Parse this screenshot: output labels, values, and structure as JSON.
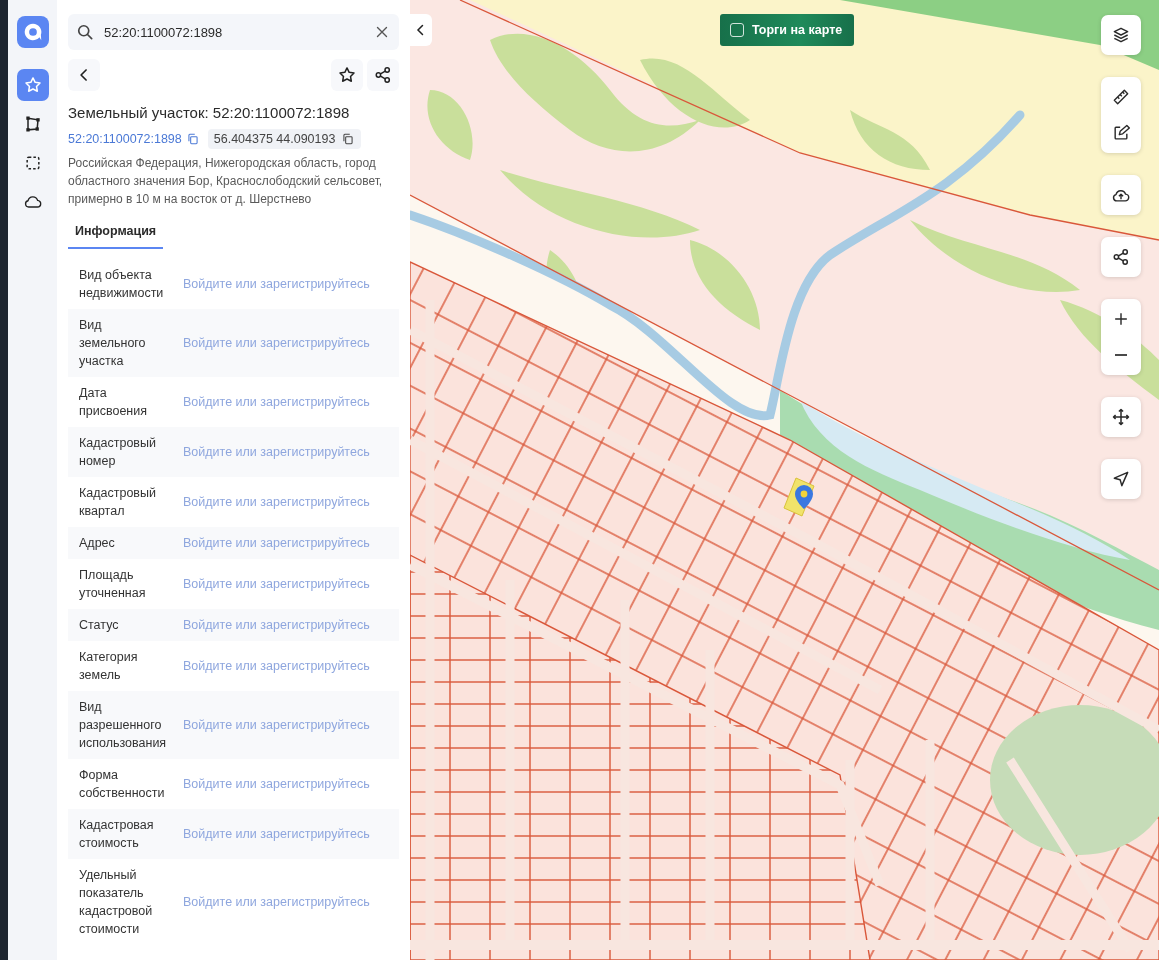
{
  "rail": [
    {
      "selected": true
    },
    {
      "selected": false
    },
    {
      "selected": false
    },
    {
      "selected": false
    }
  ],
  "search": {
    "value": "52:20:1100072:1898"
  },
  "object": {
    "title": "Земельный участок: 52:20:1100072:1898",
    "cadastral_link": "52:20:1100072:1898",
    "coordinates": "56.404375 44.090193",
    "address": "Российская Федерация, Нижегородская область, город областного значения Бор, Краснослободский сельсовет, примерно в 10 м на восток от д. Шерстнево"
  },
  "tabs": [
    {
      "label": "Информация",
      "selected": true
    }
  ],
  "rows": [
    {
      "label": "Вид объекта недвижимости",
      "value": "Войдите или зарегистрируйтесь"
    },
    {
      "label": "Вид земельного участка",
      "value": "Войдите или зарегистрируйтесь"
    },
    {
      "label": "Дата присвоения",
      "value": "Войдите или зарегистрируйтесь"
    },
    {
      "label": "Кадастровый номер",
      "value": "Войдите или зарегистрируйтесь"
    },
    {
      "label": "Кадастровый квартал",
      "value": "Войдите или зарегистрируйтесь"
    },
    {
      "label": "Адрес",
      "value": "Войдите или зарегистрируйтесь"
    },
    {
      "label": "Площадь уточненная",
      "value": "Войдите или зарегистрируйтесь"
    },
    {
      "label": "Статус",
      "value": "Войдите или зарегистрируйтесь"
    },
    {
      "label": "Категория земель",
      "value": "Войдите или зарегистрируйтесь"
    },
    {
      "label": "Вид разрешенного использования",
      "value": "Войдите или зарегистрируйтесь"
    },
    {
      "label": "Форма собственности",
      "value": "Войдите или зарегистрируйтесь"
    },
    {
      "label": "Кадастровая стоимость",
      "value": "Войдите или зарегистрируйтесь"
    },
    {
      "label": "Удельный показатель кадастровой стоимости",
      "value": "Войдите или зарегистрируйтесь"
    }
  ],
  "map": {
    "auctions_toggle": {
      "label": "Торги на карте",
      "checked": false
    }
  }
}
